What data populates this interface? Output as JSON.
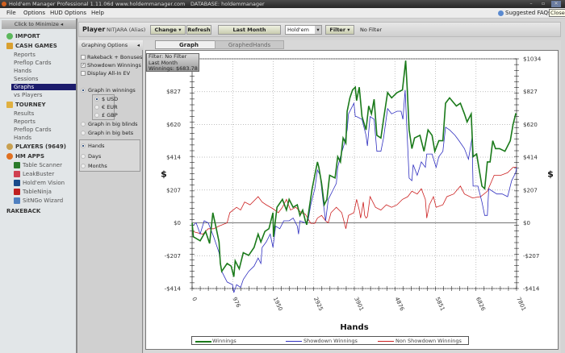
{
  "titlebar": {
    "title": "Hold'em Manager Professional 1.11.06d",
    "url": "www.holdemmanager.com",
    "database": "DATABASE: holdemmanager",
    "close_tooltip": "Close"
  },
  "menu": [
    "File",
    "Options",
    "HUD Options",
    "Help"
  ],
  "suggested": "Suggested FAQs",
  "sidebar": {
    "minimize": "Click to Minimize",
    "import": "IMPORT",
    "cash_games": "CASH GAMES",
    "cash_items": [
      "Reports",
      "Preflop Cards",
      "Hands",
      "Sessions",
      "Graphs",
      "vs Players"
    ],
    "tourney": "TOURNEY",
    "tourney_items": [
      "Results",
      "Reports",
      "Preflop Cards",
      "Hands"
    ],
    "players": "PLAYERS (9649)",
    "hm_apps": "HM APPS",
    "apps": [
      "Table Scanner",
      "LeakBuster",
      "Hold'em Vision",
      "TableNinja",
      "SitNGo Wizard"
    ],
    "rakeback": "RAKEBACK"
  },
  "playerbar": {
    "label": "Player",
    "player": "NITJARA (Alias)",
    "change": "Change",
    "refresh": "Refresh",
    "period": "Last Month",
    "game": "Hold'em",
    "filter": "Filter",
    "filter_status": "No Filter"
  },
  "options": {
    "title": "Graphing Options",
    "checkboxes": [
      {
        "label": "Rakeback + Bonuses",
        "checked": false
      },
      {
        "label": "Showdown Winnings",
        "checked": true
      },
      {
        "label": "Display All-In EV",
        "checked": false
      }
    ],
    "graph_in_winnings": "Graph in winnings",
    "currencies": [
      "$ USD",
      "€ EUR",
      "£ GBP"
    ],
    "graph_bb": "Graph in big blinds",
    "graph_bets": "Graph in big bets",
    "xaxis": [
      "Hands",
      "Days",
      "Months"
    ]
  },
  "tabs": [
    "Graph",
    "GraphedHands"
  ],
  "info": {
    "line1": "Filter: No Filter",
    "line2": "Last Month",
    "line3": "Winnings: $683.78"
  },
  "chart_data": {
    "type": "line",
    "xlabel": "Hands",
    "ylabel": "$",
    "xlim": [
      0,
      7801
    ],
    "ylim": [
      -414,
      1034
    ],
    "xticks": [
      0,
      976,
      1950,
      2925,
      3901,
      4876,
      5851,
      6826,
      7801
    ],
    "yticks": [
      -414,
      -207,
      0,
      207,
      414,
      620,
      827,
      1034
    ],
    "ytick_labels": [
      "-$414",
      "-$207",
      "$0",
      "$207",
      "$414",
      "$620",
      "$827",
      "$1034"
    ],
    "grid": true,
    "legend_position": "bottom",
    "series": [
      {
        "name": "Winnings",
        "color": "#1a7a1a",
        "points": [
          [
            0,
            0
          ],
          [
            32,
            -88
          ],
          [
            194,
            -113
          ],
          [
            324,
            -54
          ],
          [
            421,
            -130
          ],
          [
            499,
            64
          ],
          [
            583,
            -37
          ],
          [
            648,
            -121
          ],
          [
            680,
            -256
          ],
          [
            713,
            -306
          ],
          [
            842,
            -256
          ],
          [
            940,
            -273
          ],
          [
            1004,
            -340
          ],
          [
            1037,
            -239
          ],
          [
            1134,
            -290
          ],
          [
            1231,
            -188
          ],
          [
            1361,
            -205
          ],
          [
            1491,
            -155
          ],
          [
            1588,
            -71
          ],
          [
            1653,
            -121
          ],
          [
            1750,
            -54
          ],
          [
            1847,
            -37
          ],
          [
            1944,
            64
          ],
          [
            1957,
            -88
          ],
          [
            2042,
            98
          ],
          [
            2172,
            148
          ],
          [
            2269,
            81
          ],
          [
            2333,
            148
          ],
          [
            2430,
            98
          ],
          [
            2528,
            114
          ],
          [
            2593,
            47
          ],
          [
            2658,
            81
          ],
          [
            2722,
            13
          ],
          [
            2755,
            -12
          ],
          [
            2820,
            98
          ],
          [
            2885,
            215
          ],
          [
            2950,
            300
          ],
          [
            3014,
            384
          ],
          [
            3047,
            350
          ],
          [
            3112,
            249
          ],
          [
            3177,
            114
          ],
          [
            3241,
            148
          ],
          [
            3306,
            300
          ],
          [
            3436,
            283
          ],
          [
            3501,
            417
          ],
          [
            3566,
            384
          ],
          [
            3631,
            535
          ],
          [
            3696,
            502
          ],
          [
            3728,
            703
          ],
          [
            3793,
            788
          ],
          [
            3858,
            838
          ],
          [
            3923,
            855
          ],
          [
            3954,
            771
          ],
          [
            4019,
            855
          ],
          [
            4084,
            670
          ],
          [
            4181,
            586
          ],
          [
            4246,
            737
          ],
          [
            4311,
            687
          ],
          [
            4376,
            779
          ],
          [
            4441,
            552
          ],
          [
            4538,
            535
          ],
          [
            4603,
            653
          ],
          [
            4700,
            821
          ],
          [
            4797,
            788
          ],
          [
            4927,
            821
          ],
          [
            5057,
            838
          ],
          [
            5108,
            956
          ],
          [
            5134,
            1023
          ],
          [
            5173,
            838
          ],
          [
            5219,
            586
          ],
          [
            5284,
            468
          ],
          [
            5348,
            535
          ],
          [
            5478,
            552
          ],
          [
            5576,
            451
          ],
          [
            5673,
            586
          ],
          [
            5770,
            552
          ],
          [
            5835,
            451
          ],
          [
            5932,
            518
          ],
          [
            6029,
            518
          ],
          [
            6094,
            754
          ],
          [
            6191,
            788
          ],
          [
            6354,
            737
          ],
          [
            6451,
            754
          ],
          [
            6548,
            687
          ],
          [
            6612,
            636
          ],
          [
            6710,
            687
          ],
          [
            6755,
            417
          ],
          [
            6840,
            434
          ],
          [
            6905,
            333
          ],
          [
            6969,
            232
          ],
          [
            7034,
            215
          ],
          [
            7099,
            384
          ],
          [
            7164,
            384
          ],
          [
            7229,
            518
          ],
          [
            7294,
            468
          ],
          [
            7391,
            468
          ],
          [
            7521,
            451
          ],
          [
            7650,
            518
          ],
          [
            7715,
            619
          ],
          [
            7780,
            687
          ],
          [
            7801,
            684
          ]
        ]
      },
      {
        "name": "Showdown Winnings",
        "color": "#3030c0",
        "points": [
          [
            0,
            -20
          ],
          [
            97,
            0
          ],
          [
            194,
            -70
          ],
          [
            292,
            13
          ],
          [
            389,
            0
          ],
          [
            518,
            -88
          ],
          [
            648,
            -188
          ],
          [
            713,
            -306
          ],
          [
            842,
            -373
          ],
          [
            972,
            -390
          ],
          [
            1004,
            -440
          ],
          [
            1069,
            -390
          ],
          [
            1166,
            -407
          ],
          [
            1231,
            -357
          ],
          [
            1361,
            -306
          ],
          [
            1491,
            -273
          ],
          [
            1588,
            -222
          ],
          [
            1653,
            -256
          ],
          [
            1685,
            -155
          ],
          [
            1782,
            -121
          ],
          [
            1879,
            -71
          ],
          [
            1944,
            -155
          ],
          [
            2009,
            -20
          ],
          [
            2107,
            -37
          ],
          [
            2204,
            13
          ],
          [
            2333,
            13
          ],
          [
            2430,
            30
          ],
          [
            2528,
            -20
          ],
          [
            2560,
            -71
          ],
          [
            2593,
            13
          ],
          [
            2722,
            0
          ],
          [
            2787,
            13
          ],
          [
            2852,
            114
          ],
          [
            2950,
            215
          ],
          [
            3014,
            333
          ],
          [
            3079,
            300
          ],
          [
            3144,
            148
          ],
          [
            3209,
            13
          ],
          [
            3274,
            148
          ],
          [
            3371,
            198
          ],
          [
            3468,
            249
          ],
          [
            3501,
            350
          ],
          [
            3566,
            417
          ],
          [
            3663,
            502
          ],
          [
            3728,
            586
          ],
          [
            3761,
            687
          ],
          [
            3825,
            720
          ],
          [
            3890,
            754
          ],
          [
            3923,
            670
          ],
          [
            3954,
            670
          ],
          [
            4084,
            653
          ],
          [
            4181,
            552
          ],
          [
            4214,
            485
          ],
          [
            4279,
            670
          ],
          [
            4376,
            653
          ],
          [
            4441,
            451
          ],
          [
            4538,
            451
          ],
          [
            4603,
            535
          ],
          [
            4700,
            720
          ],
          [
            4797,
            687
          ],
          [
            4927,
            704
          ],
          [
            5024,
            704
          ],
          [
            5069,
            653
          ],
          [
            5121,
            838
          ],
          [
            5219,
            282
          ],
          [
            5284,
            266
          ],
          [
            5316,
            367
          ],
          [
            5413,
            300
          ],
          [
            5511,
            384
          ],
          [
            5608,
            350
          ],
          [
            5641,
            434
          ],
          [
            5770,
            434
          ],
          [
            5867,
            350
          ],
          [
            5932,
            417
          ],
          [
            6029,
            451
          ],
          [
            6094,
            603
          ],
          [
            6191,
            586
          ],
          [
            6321,
            552
          ],
          [
            6418,
            518
          ],
          [
            6548,
            468
          ],
          [
            6645,
            401
          ],
          [
            6729,
            535
          ],
          [
            6755,
            232
          ],
          [
            6872,
            232
          ],
          [
            6969,
            131
          ],
          [
            7034,
            47
          ],
          [
            7099,
            47
          ],
          [
            7132,
            215
          ],
          [
            7229,
            198
          ],
          [
            7326,
            182
          ],
          [
            7456,
            182
          ],
          [
            7585,
            165
          ],
          [
            7683,
            266
          ],
          [
            7780,
            316
          ],
          [
            7801,
            350
          ]
        ]
      },
      {
        "name": "Non Showdown Winnings",
        "color": "#cc2020",
        "points": [
          [
            0,
            -54
          ],
          [
            259,
            -71
          ],
          [
            389,
            -37
          ],
          [
            518,
            -37
          ],
          [
            648,
            -20
          ],
          [
            842,
            0
          ],
          [
            907,
            64
          ],
          [
            1069,
            98
          ],
          [
            1166,
            81
          ],
          [
            1264,
            131
          ],
          [
            1393,
            114
          ],
          [
            1588,
            165
          ],
          [
            1685,
            131
          ],
          [
            1782,
            114
          ],
          [
            1944,
            89
          ],
          [
            2074,
            64
          ],
          [
            2172,
            98
          ],
          [
            2269,
            148
          ],
          [
            2366,
            81
          ],
          [
            2495,
            98
          ],
          [
            2625,
            64
          ],
          [
            2722,
            55
          ],
          [
            2852,
            -3
          ],
          [
            2950,
            -3
          ],
          [
            3014,
            30
          ],
          [
            3112,
            47
          ],
          [
            3209,
            13
          ],
          [
            3274,
            0
          ],
          [
            3339,
            64
          ],
          [
            3468,
            98
          ],
          [
            3598,
            64
          ],
          [
            3696,
            -37
          ],
          [
            3761,
            47
          ],
          [
            3890,
            64
          ],
          [
            4019,
            81
          ],
          [
            4116,
            131
          ],
          [
            4181,
            30
          ],
          [
            4214,
            39
          ],
          [
            3954,
            148
          ],
          [
            4051,
            30
          ],
          [
            4149,
            47
          ],
          [
            4279,
            165
          ],
          [
            4408,
            98
          ],
          [
            4538,
            81
          ],
          [
            4668,
            114
          ],
          [
            4797,
            98
          ],
          [
            4927,
            114
          ],
          [
            5057,
            148
          ],
          [
            5186,
            165
          ],
          [
            5284,
            199
          ],
          [
            5413,
            182
          ],
          [
            5511,
            215
          ],
          [
            5608,
            148
          ],
          [
            5641,
            30
          ],
          [
            5705,
            114
          ],
          [
            5802,
            165
          ],
          [
            5867,
            98
          ],
          [
            6029,
            114
          ],
          [
            6126,
            165
          ],
          [
            6289,
            182
          ],
          [
            6451,
            232
          ],
          [
            6548,
            182
          ],
          [
            6742,
            157
          ],
          [
            6937,
            165
          ],
          [
            7099,
            199
          ],
          [
            7261,
            300
          ],
          [
            7423,
            300
          ],
          [
            7585,
            316
          ],
          [
            7715,
            350
          ],
          [
            7801,
            350
          ]
        ]
      }
    ]
  }
}
